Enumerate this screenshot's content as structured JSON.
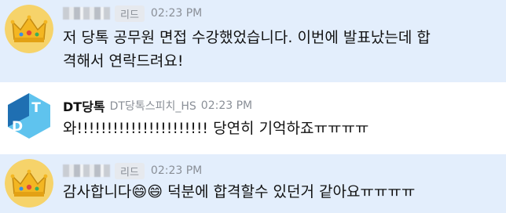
{
  "messages": [
    {
      "badge": "리드",
      "time": "02:23 PM",
      "text": "저 당톡 공무원 면접 수강했었습니다. 이번에 발표났는데 합\n격해서 연락드려요!"
    },
    {
      "sender": "DT당톡",
      "sender_sub": "DT당톡스피치_HS",
      "time": "02:23 PM",
      "text": "와!!!!!!!!!!!!!!!!!!!!!! 당연히 기억하죠ㅠㅠㅠㅠ"
    },
    {
      "badge": "리드",
      "time": "02:23 PM",
      "text_before": "감사합니다",
      "emoji": "😄😄",
      "text_after": " 덕분에 합격할수 있던거 같아요ㅠㅠㅠㅠ"
    }
  ],
  "logo": {
    "letters": [
      "D",
      "T"
    ],
    "colors": {
      "dark": "#1f6fb2",
      "light": "#5fc3ee"
    }
  },
  "crown_colors": {
    "gold": "#f3b622",
    "bg": "#f6d36a",
    "red": "#e4463c",
    "blue": "#3c8ee4",
    "green": "#3cae5a"
  }
}
